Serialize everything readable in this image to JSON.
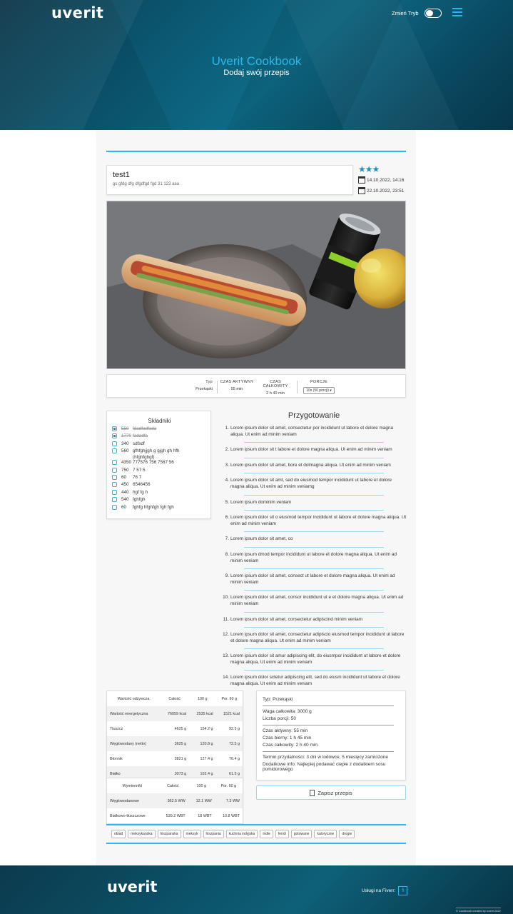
{
  "header": {
    "logo": "uverit",
    "mode_label": "Zmień Tryb",
    "title": "Uverit Cookbook",
    "subtitle": "Dodaj swój przepis"
  },
  "recipe": {
    "title": "test1",
    "description": "gs gfdg dfg dfgdfgd fgd 31 123 aaa",
    "stars": "★★★",
    "created": "14.10.2022, 14:16",
    "updated": "22.10.2022, 23:51"
  },
  "info_bar": {
    "type_label": "Typ",
    "type_value": "Przekąski",
    "active_label": "CZAS AKTYWNY",
    "active_value": "55 min",
    "total_label": "CZAS CAŁKOWITY",
    "total_value": "2 h 40 min",
    "portions_label": "PORCJE",
    "portions_select": "10x (50 porcji)"
  },
  "ingredients": {
    "title": "Składniki",
    "items": [
      {
        "qty": "550",
        "name": "fdadfadfada",
        "checked": true
      },
      {
        "qty": "1770",
        "name": "fadadfa",
        "checked": true
      },
      {
        "qty": "340",
        "name": "sdfsdf",
        "checked": false
      },
      {
        "qty": "560",
        "name": "gfhfghjjgh g gjgh gh hfh (hfghfghgf)",
        "checked": false
      },
      {
        "qty": "4350",
        "name": "777576 756 7567 56",
        "checked": false
      },
      {
        "qty": "750",
        "name": "7 57 5",
        "checked": false
      },
      {
        "qty": "60",
        "name": "76 7",
        "checked": false
      },
      {
        "qty": "450",
        "name": "6546456",
        "checked": false
      },
      {
        "qty": "440",
        "name": "hgf fg h",
        "checked": false
      },
      {
        "qty": "540",
        "name": "fghfgh",
        "checked": false
      },
      {
        "qty": "60",
        "name": "fghfg hfghfgh fgh fgh",
        "checked": false
      }
    ]
  },
  "preparation": {
    "title": "Przygotowanie",
    "steps": [
      "Lorem ipsum dolor sit amet, consectetur por incididunt ut labore et dolore magna aliqua. Ut enim ad minim veniam",
      "Lorem ipsum dolor sit t labore et dolore magna aliqua. Ut enim ad minim veniam",
      "Lorem ipsum dolor sit amet, bore et dolmagna aliqua. Ut enim ad minim veniam",
      "Lorem ipsum dolor sit amt, sed do eiusmod tempor incididunt ut labore et dolore magna aliqua. Ut enim ad minim veniamg",
      "Lorem ipsum dominim veniam",
      "Lorem ipsum dolor sit o eiusmod tempor incididunt ut labore et dolore magna aliqua. Ut enim ad minim veniam",
      "Lorem ipsum dolor sit amet, co",
      "Lorem ipsum dmod tempor incididunt ut labore et dolore magna aliqua. Ut enim ad minim veniam",
      "Lorem ipsum dolor sit amet, consect ut labore et dolore magna aliqua. Ut enim ad minim veniam",
      "Lorem ipsum dolor sit amet, consor incididunt ut e et dolore magna aliqua. Ut enim ad minim veniam",
      "Lorem ipsum dolor sit amet, consectetur adipiscind minim veniam",
      "Lorem ipsum dolor sit amet, consectetur adipiscio eiusmod tempor incididunt ut labore et dolore magna aliqua. Ut enim ad minim veniam",
      "Lorem ipsum dolor sit amur adipiscing elit, do eiusmpor incididunt ut labore et dolore magna aliqua. Ut enim ad minim veniam",
      "Lorem ipsum dolor sctetur adipiscing elit, sed do eiusm incididunt ut labore et dolore magna aliqua. Ut enim ad minim veniam"
    ]
  },
  "nutrition": {
    "headers": [
      "Wartość odżywcza",
      "Całość",
      "100 g",
      "Por. 60 g"
    ],
    "rows": [
      [
        "Wartość energetyczna",
        "76059 kcal",
        "2535 kcal",
        "1521 kcal"
      ],
      [
        "Tłuszcz",
        "4625 g",
        "154.2 g",
        "92.5 g"
      ],
      [
        "Węglowodany (netto)",
        "3625 g",
        "120.8 g",
        "72.5 g"
      ],
      [
        "Błonnik",
        "3821 g",
        "127.4 g",
        "76.4 g"
      ],
      [
        "Białko",
        "3073 g",
        "102.4 g",
        "61.5 g"
      ]
    ]
  },
  "exchangers": {
    "headers": [
      "Wymienniki",
      "Całość",
      "100 g",
      "Por. 60 g"
    ],
    "rows": [
      [
        "Węglowodanowe",
        "362.5 WW",
        "12.1 WW",
        "7.3 WW"
      ],
      [
        "Białkowo-tłuszczowe",
        "539.2 WBT",
        "18 WBT",
        "10.8 WBT"
      ]
    ]
  },
  "details": {
    "type": "Typ: Przekąski",
    "weight": "Waga całkowita: 3000 g",
    "portions": "Liczba porcji: 50",
    "active": "Czas aktywny: 55 min",
    "passive": "Czas bierny: 1 h 45 min",
    "total": "Czas całkowity: 2 h 40 min",
    "shelf": "Termin przydatności: 3 dni w lodówce, 5 miesięcy zamrożone",
    "extra": "Dodatkowe info: Najlepiej podawać ciepłe z dodatkiem sosu pomidorowego"
  },
  "save_button": "Zapisz przepis",
  "tags": [
    "obiad",
    "meksykanska",
    "hiszpanska",
    "meksyk",
    "hiszpania",
    "kuchnia indyjska",
    "indie",
    "fendi",
    "gotowane",
    "kaloryczne",
    "drogie"
  ],
  "footer": {
    "logo": "uverit",
    "fiverr_label": "Usługi na Fiverr:",
    "fiverr_icon": "fi",
    "copyright": "© Cookbook created by uverit 2022"
  },
  "colors": {
    "accent": "#2ab8ea",
    "header_bg": "#0b5670",
    "star": "#1e8fbf"
  }
}
